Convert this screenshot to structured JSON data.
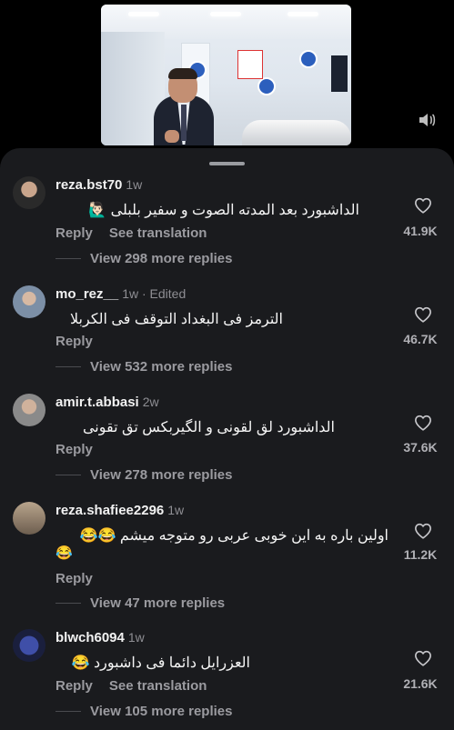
{
  "colors": {
    "sheet_bg": "#1a1b1e",
    "muted": "#9b9ba0",
    "text": "#f2f2f2"
  },
  "icons": {
    "volume": "volume-icon",
    "like": "heart-icon"
  },
  "comments": [
    {
      "username": "reza.bst70",
      "meta": "1w",
      "text": "الداشبورد بعد المدته الصوت و سفير بلبلى 🙋🏻‍♂️",
      "reply_label": "Reply",
      "translate_label": "See translation",
      "likes": "41.9K",
      "view_replies": "View 298 more replies"
    },
    {
      "username": "mo_rez__",
      "meta": "1w · Edited",
      "text": "الترمز فى البغداد التوقف فى الكربلا",
      "reply_label": "Reply",
      "likes": "46.7K",
      "view_replies": "View 532 more replies"
    },
    {
      "username": "amir.t.abbasi",
      "meta": "2w",
      "text": "الداشبورد لق لقونى و الگیربکس تق تقونى",
      "reply_label": "Reply",
      "likes": "37.6K",
      "view_replies": "View 278 more replies"
    },
    {
      "username": "reza.shafiee2296",
      "meta": "1w",
      "text": "اولین باره به این خوبی عربی رو متوجه میشم 😂😂",
      "text_line2": "😂",
      "reply_label": "Reply",
      "likes": "11.2K",
      "view_replies": "View 47 more replies"
    },
    {
      "username": "blwch6094",
      "meta": "1w",
      "text": "العزرایل دائما فی داشبورد 😂",
      "reply_label": "Reply",
      "translate_label": "See translation",
      "likes": "21.6K",
      "view_replies": "View 105 more replies"
    }
  ]
}
